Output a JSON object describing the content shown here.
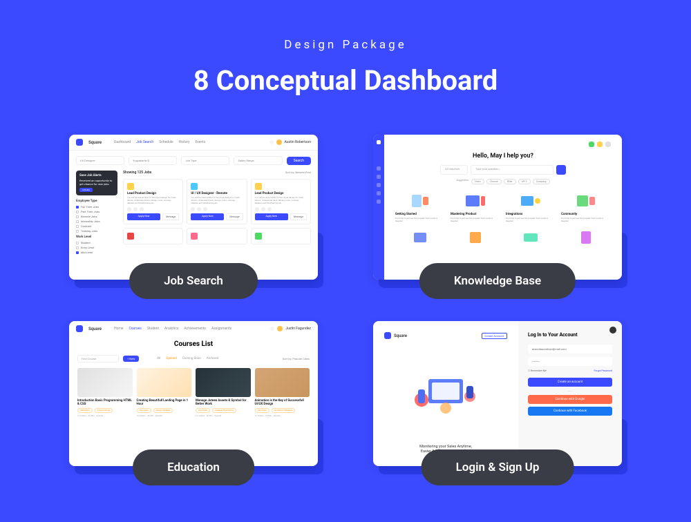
{
  "header": {
    "subtitle": "Design Package",
    "title": "8 Conceptual Dashboard"
  },
  "pills": {
    "job_search": "Job Search",
    "knowledge_base": "Knowledge Base",
    "education": "Education",
    "login": "Login & Sign Up"
  },
  "job_search": {
    "brand": "Square",
    "nav": [
      "Dashboard",
      "Job Search",
      "Schedule",
      "History",
      "Events"
    ],
    "user": "Austin Robertson",
    "search_fields": [
      "UX Designer",
      "Yogyakarta ⊘",
      "Job Type",
      "Salary Range"
    ],
    "search_btn": "Search",
    "alert": {
      "title": "Save Job Alerts",
      "desc": "Received an opportunity to get chance for new jobs.",
      "btn": "Activate"
    },
    "filter1_title": "Employee Type",
    "filter1_items": [
      "Full Time Jobs",
      "Part Time Jobs",
      "Remote Jobs",
      "Internship Jobs",
      "Contract",
      "Training Jobs"
    ],
    "filter2_title": "Work Level",
    "filter2_items": [
      "Student",
      "Entry Level",
      "Mid Level"
    ],
    "results_title": "Showing 125 Jobs",
    "sort": "Sort by: Newest Post",
    "jobs": [
      {
        "icon_color": "#ffd24c",
        "title": "Lead Product Design",
        "desc": "You will be responsible for the visual design for multi-device. Understand basic design, Color, Journey, Ideation and Wireframing etc."
      },
      {
        "icon_color": "#4cc7ff",
        "title": "UI / UX Designer - Remote",
        "desc": "You will be responsible for the visual design for multi-device. Understand basic design, Color, Journey, Ideation and Wireframing etc."
      },
      {
        "icon_color": "#ffd24c",
        "title": "Lead Product Design",
        "desc": "You will be responsible for the visual design for multi-device. Understand basic design, Color, Journey, Ideation and Wireframing etc."
      }
    ],
    "apply": "Apply Now",
    "message": "Message",
    "logo_colors": [
      "#e84545",
      "#ff6b8a",
      "#4cd964"
    ]
  },
  "knowledge_base": {
    "title": "Hello, May I help you?",
    "search_placeholder": "Type your question…",
    "search_dropdown": "All requests",
    "tags_label": "Suggestion:",
    "tags": [
      "Video",
      "Chrome",
      "Biller",
      "API 2",
      "Company"
    ],
    "items": [
      {
        "title": "Getting Started"
      },
      {
        "title": "Mastering Product"
      },
      {
        "title": "Integrations"
      },
      {
        "title": "Community"
      }
    ],
    "item_desc": "Find help to get use the program from Login & Register"
  },
  "education": {
    "brand": "Square",
    "nav": [
      "Home",
      "Courses",
      "Student",
      "Analytics",
      "Achievements",
      "Assignments"
    ],
    "user": "Justin Fagundez",
    "title": "Courses List",
    "search": "Find Course",
    "new_btn": "+ New",
    "tabs": [
      "All",
      "Opened",
      "Coming Soon",
      "Archived"
    ],
    "sort": "Sort by: Popular Class",
    "courses": [
      {
        "title": "Introduction Basic Programming HTML & CSS",
        "tags": [
          "Web Basic",
          "Programming",
          "Coding"
        ]
      },
      {
        "title": "Creating Beautifull Landing Page in 1 Hour",
        "tags": [
          "Hey Pixel!",
          "Design Website"
        ]
      },
      {
        "title": "Manage Juteen Assets & Symbol for Better Work",
        "tags": [
          "Hey Pixel!",
          "Gateway Experience"
        ]
      },
      {
        "title": "Animation is the Key of Successfull UI/UX Design",
        "tags": [
          "Hey Pixel!",
          "Animation Websites"
        ]
      }
    ],
    "stats": "12 Videos · 36 Min · Opened"
  },
  "login": {
    "brand": "Square",
    "create": "Create Account",
    "tagline1": "Monitoring your Sales Anytime,",
    "tagline2": "Easier & Effective than Before",
    "form_title": "Log In to Your Account",
    "email": "aranvidopoetoyo@mail.com",
    "password": "••••••••",
    "remember": "Remember Me",
    "forgot": "Forgot Password",
    "btn_create": "Create an account",
    "btn_google": "Continue with Google",
    "btn_facebook": "Continue with Facebook"
  }
}
